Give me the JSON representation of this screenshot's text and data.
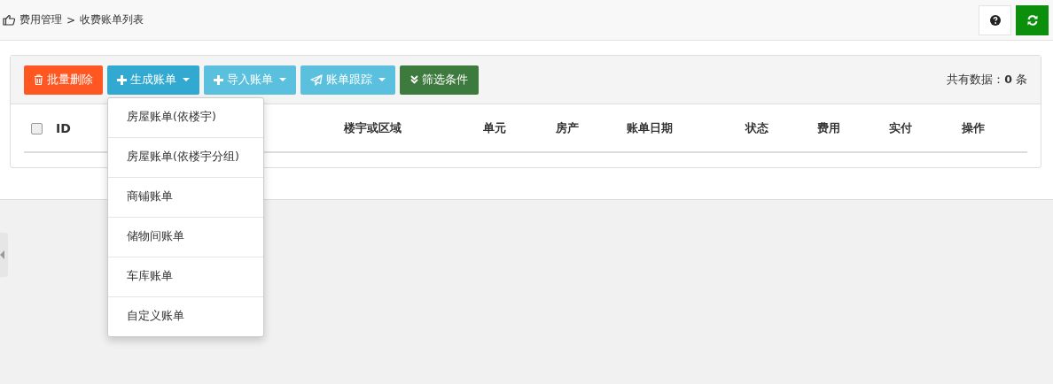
{
  "breadcrumb": {
    "items": [
      "费用管理",
      ">",
      "收费账单列表"
    ]
  },
  "toolbar": {
    "buttons": [
      {
        "label": "批量删除",
        "kind": "delete",
        "dropdown": false,
        "expanded": false
      },
      {
        "label": "生成账单",
        "kind": "add",
        "dropdown": true,
        "expanded": true
      },
      {
        "label": "导入账单",
        "kind": "add",
        "dropdown": true,
        "expanded": false
      },
      {
        "label": "账单跟踪",
        "kind": "send",
        "dropdown": true,
        "expanded": false
      },
      {
        "label": "筛选条件",
        "kind": "filter",
        "dropdown": false,
        "expanded": false
      }
    ],
    "count": "共有数据：**0** 条"
  },
  "dropdown_menu": {
    "items": [
      "房屋账单(依楼宇)",
      "房屋账单(依楼宇分组)",
      "商铺账单",
      "储物间账单",
      "车库账单",
      "自定义账单"
    ]
  },
  "table": {
    "select_all": {
      "checked": false
    },
    "columns": [
      "ID",
      "楼宇或区域",
      "单元",
      "房产",
      "账单日期",
      "状态",
      "费用",
      "实付",
      "操作"
    ]
  }
}
